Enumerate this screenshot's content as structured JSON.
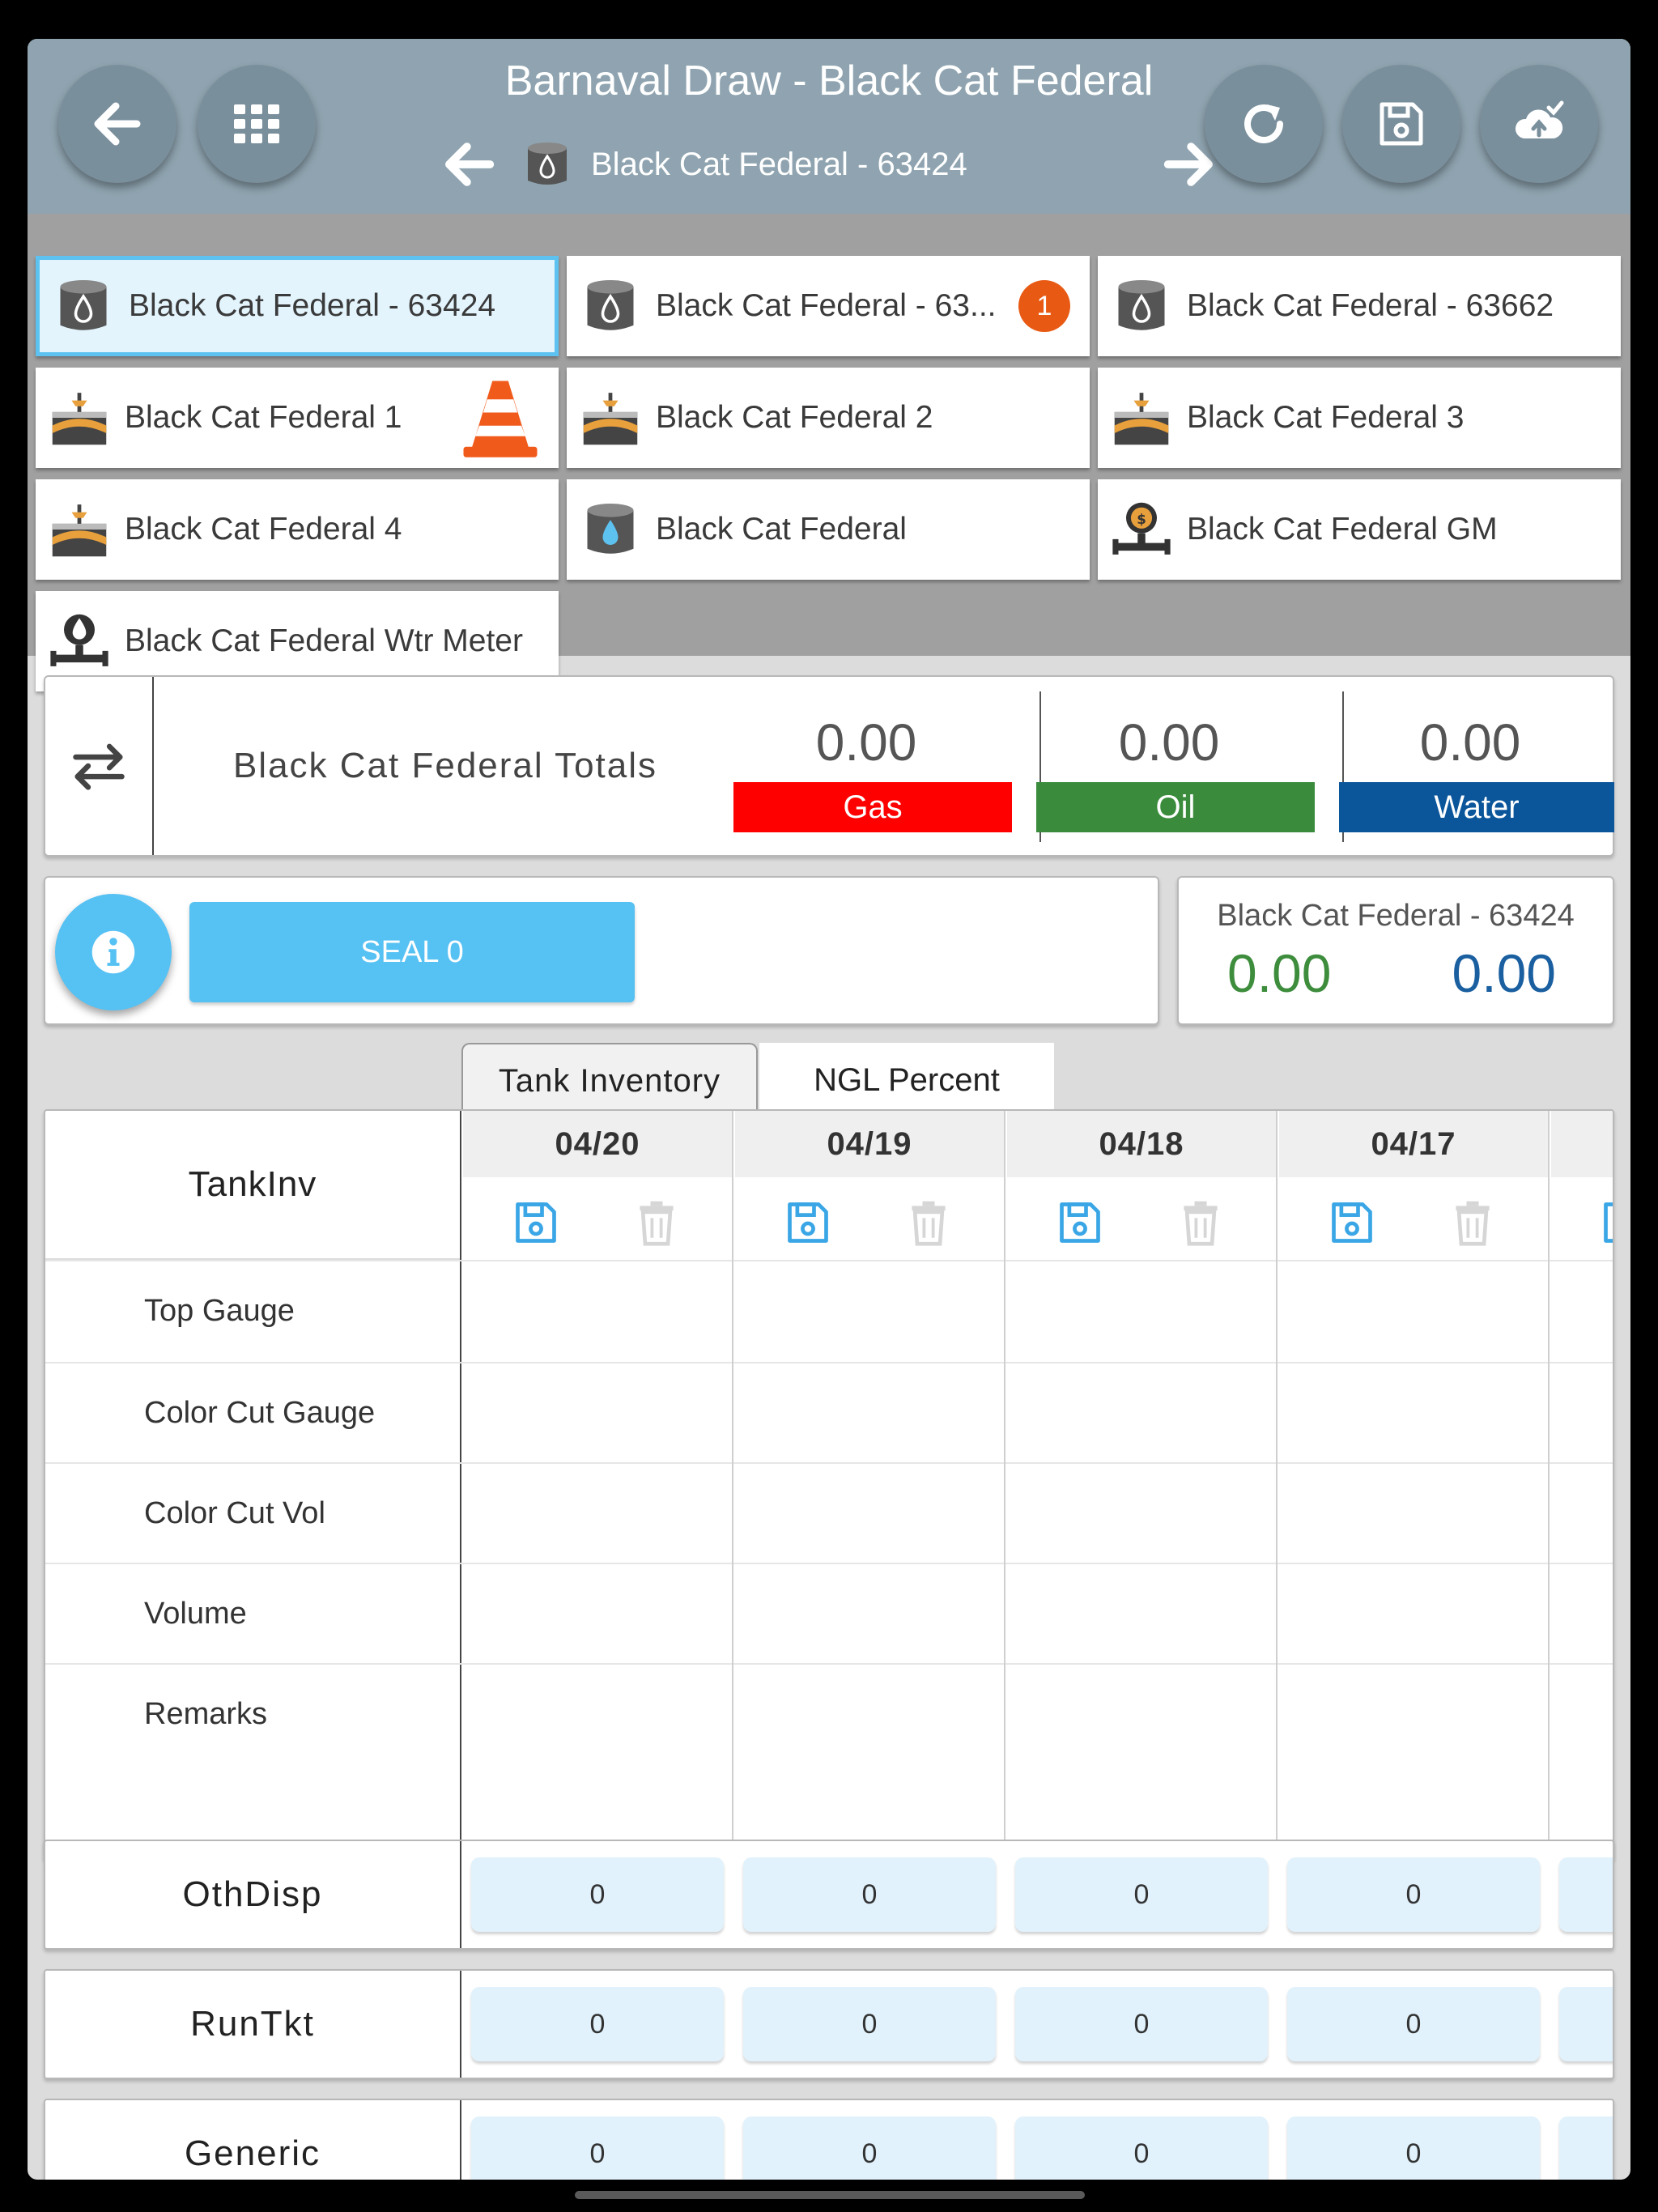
{
  "header": {
    "title": "Barnaval Draw - Black Cat Federal",
    "subtitle": "Black Cat Federal - 63424"
  },
  "tiles": [
    {
      "label": "Black Cat Federal - 63424",
      "icon": "oil-tank-icon",
      "selected": true
    },
    {
      "label": "Black Cat Federal - 63...",
      "icon": "oil-tank-icon",
      "badge": "1"
    },
    {
      "label": "Black Cat Federal - 63662",
      "icon": "oil-tank-icon"
    },
    {
      "label": "Black Cat Federal 1",
      "icon": "well-icon",
      "alert": "traffic-cone-icon"
    },
    {
      "label": "Black Cat Federal 2",
      "icon": "well-icon"
    },
    {
      "label": "Black Cat Federal 3",
      "icon": "well-icon"
    },
    {
      "label": "Black Cat Federal 4",
      "icon": "well-icon"
    },
    {
      "label": "Black Cat Federal",
      "icon": "water-tank-icon"
    },
    {
      "label": "Black Cat Federal GM",
      "icon": "gas-meter-icon"
    },
    {
      "label": "Black Cat Federal Wtr Meter",
      "icon": "water-meter-icon"
    }
  ],
  "totals": {
    "title": "Black Cat Federal Totals",
    "gas": {
      "value": "0.00",
      "label": "Gas",
      "color": "#ff0000"
    },
    "oil": {
      "value": "0.00",
      "label": "Oil",
      "color": "#3a8c3c"
    },
    "water": {
      "value": "0.00",
      "label": "Water",
      "color": "#0b559b"
    }
  },
  "seal": {
    "label": "SEAL 0"
  },
  "well_summary": {
    "name": "Black Cat Federal - 63424",
    "oil": "0.00",
    "water": "0.00"
  },
  "tabs": [
    {
      "label": "Tank Inventory",
      "active": true
    },
    {
      "label": "NGL Percent",
      "active": false
    }
  ],
  "grid": {
    "title": "TankInv",
    "rows": [
      "Top Gauge",
      "Color Cut Gauge",
      "Color Cut Vol",
      "Volume",
      "Remarks"
    ],
    "dates": [
      "04/20",
      "04/19",
      "04/18",
      "04/17"
    ]
  },
  "bottom_rows": [
    {
      "label": "OthDisp",
      "values": [
        "0",
        "0",
        "0",
        "0"
      ]
    },
    {
      "label": "RunTkt",
      "values": [
        "0",
        "0",
        "0",
        "0"
      ]
    },
    {
      "label": "Generic",
      "values": [
        "0",
        "0",
        "0",
        "0"
      ]
    }
  ]
}
